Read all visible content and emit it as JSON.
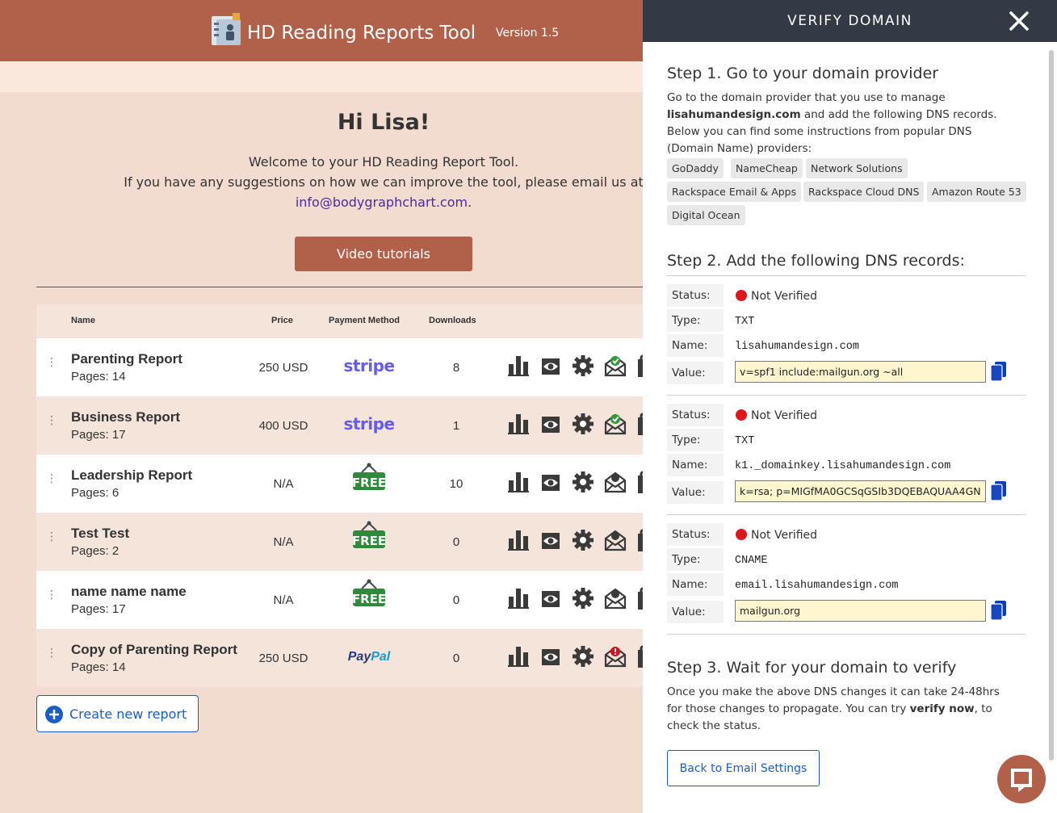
{
  "header": {
    "title": "HD Reading Reports Tool",
    "version": "Version 1.5"
  },
  "welcome": {
    "greeting": "Hi Lisa!",
    "line1": "Welcome to your HD Reading Report Tool.",
    "line2": "If you have any suggestions on how we can improve the tool, please email us at",
    "email": "info@bodygraphchart.com",
    "email_suffix": ".",
    "video_button": "Video tutorials"
  },
  "table": {
    "headers": {
      "name": "Name",
      "price": "Price",
      "payment": "Payment Method",
      "downloads": "Downloads"
    },
    "rows": [
      {
        "name": "Parenting Report",
        "pages": "Pages: 14",
        "price": "250 USD",
        "payment": "stripe",
        "downloads": "8",
        "email_status": "verified"
      },
      {
        "name": "Business Report",
        "pages": "Pages: 17",
        "price": "400 USD",
        "payment": "stripe",
        "downloads": "1",
        "email_status": "verified"
      },
      {
        "name": "Leadership Report",
        "pages": "Pages: 6",
        "price": "N/A",
        "payment": "free",
        "downloads": "10",
        "email_status": "none"
      },
      {
        "name": "Test Test",
        "pages": "Pages: 2",
        "price": "N/A",
        "payment": "free",
        "downloads": "0",
        "email_status": "none"
      },
      {
        "name": "name name name",
        "pages": "Pages: 17",
        "price": "N/A",
        "payment": "free",
        "downloads": "0",
        "email_status": "none"
      },
      {
        "name": "Copy of Parenting Report",
        "pages": "Pages: 14",
        "price": "250 USD",
        "payment": "paypal",
        "downloads": "0",
        "email_status": "error"
      }
    ],
    "payment_labels": {
      "stripe": "stripe",
      "free": "FREE",
      "paypal_a": "Pay",
      "paypal_b": "Pal"
    }
  },
  "create_button": "Create new report",
  "panel": {
    "title": "VERIFY DOMAIN",
    "step1": {
      "heading": "Step 1. Go to your domain provider",
      "text_a": "Go to the domain provider that you use to manage",
      "domain": "lisahumandesign.com",
      "text_b": " and add the following DNS records.",
      "text_c": "Below you can find some instructions from popular DNS",
      "text_d": "(Domain Name) providers:",
      "providers": [
        "GoDaddy",
        "NameCheap",
        "Network Solutions",
        "Rackspace Email & Apps",
        "Rackspace Cloud DNS",
        "Amazon Route 53",
        "Digital Ocean"
      ]
    },
    "step2": {
      "heading": "Step 2. Add the following DNS records:",
      "labels": {
        "status": "Status:",
        "type": "Type:",
        "name": "Name:",
        "value": "Value:"
      },
      "records": [
        {
          "status": "Not Verified",
          "type": "TXT",
          "name": "lisahumandesign.com",
          "value": "v=spf1 include:mailgun.org ~all"
        },
        {
          "status": "Not Verified",
          "type": "TXT",
          "name": "k1._domainkey.lisahumandesign.com",
          "value": "k=rsa; p=MIGfMA0GCSqGSIb3DQEBAQUAA4GN"
        },
        {
          "status": "Not Verified",
          "type": "CNAME",
          "name": "email.lisahumandesign.com",
          "value": "mailgun.org"
        }
      ]
    },
    "step3": {
      "heading": "Step 3. Wait for your domain to verify",
      "line1": "Once you make the above DNS changes it can take 24-48hrs",
      "line2a": "for those changes to propagate. You can try ",
      "verify_now": "verify now",
      "line2b": ", to",
      "line3": "check the status."
    },
    "back_button": "Back to Email Settings"
  },
  "colors": {
    "brand": "#b1614a",
    "panel_header": "#333a45",
    "link_blue": "#1a5dc9",
    "status_red": "#e0161e"
  }
}
